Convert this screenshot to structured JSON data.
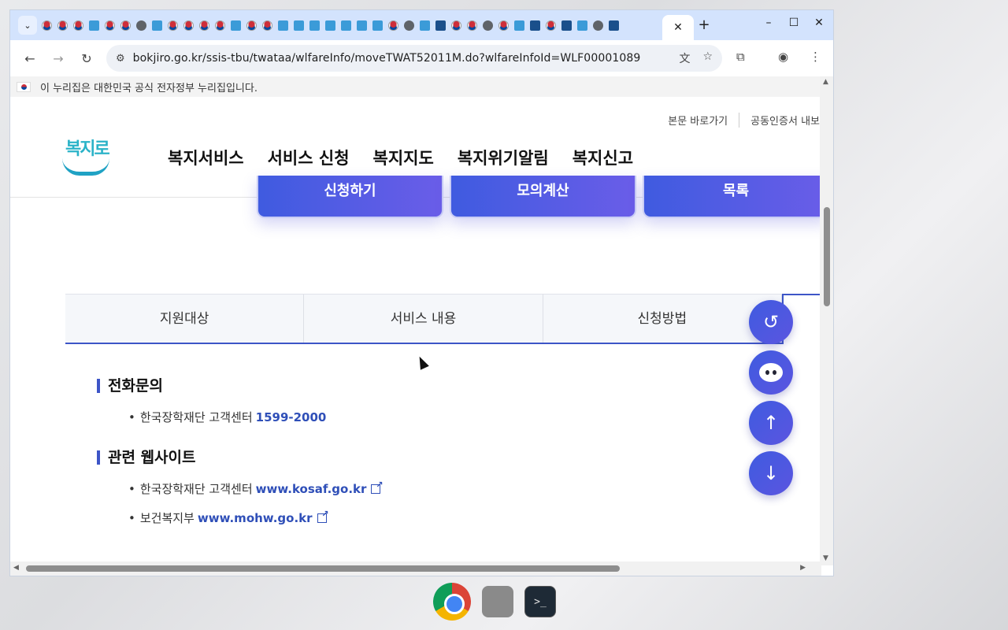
{
  "browser": {
    "active_tab_close": "✕",
    "new_tab": "+",
    "window_controls": {
      "minimize": "–",
      "maximize": "☐",
      "close": "✕"
    },
    "url": "bokjiro.go.kr/ssis-tbu/twataa/wlfareInfo/moveTWAT52011M.do?wlfareInfoId=WLF00001089"
  },
  "page": {
    "gov_banner": "이 누리집은 대한민국 공식 전자정부 누리집입니다.",
    "util_links": [
      "본문 바로가기",
      "공동인증서 내보"
    ],
    "logo_text": "복지로",
    "gnb": [
      "복지서비스",
      "서비스 신청",
      "복지지도",
      "복지위기알림",
      "복지신고"
    ],
    "actions": [
      "신청하기",
      "모의계산",
      "목록"
    ],
    "tabs": [
      "지원대상",
      "서비스 내용",
      "신청방법"
    ],
    "sections": {
      "phone": {
        "title": "전화문의",
        "items": [
          {
            "text": "한국장학재단 고객센터",
            "link": "1599-2000"
          }
        ]
      },
      "websites": {
        "title": "관련 웹사이트",
        "items": [
          {
            "text": "한국장학재단 고객센터",
            "link": "www.kosaf.go.kr"
          },
          {
            "text": "보건복지부",
            "link": "www.mohw.go.kr"
          }
        ]
      }
    },
    "floating": [
      "history-icon",
      "chatbot-icon",
      "scroll-up-icon",
      "scroll-down-icon"
    ]
  },
  "taskbar": [
    "chrome",
    "tool",
    "terminal"
  ]
}
